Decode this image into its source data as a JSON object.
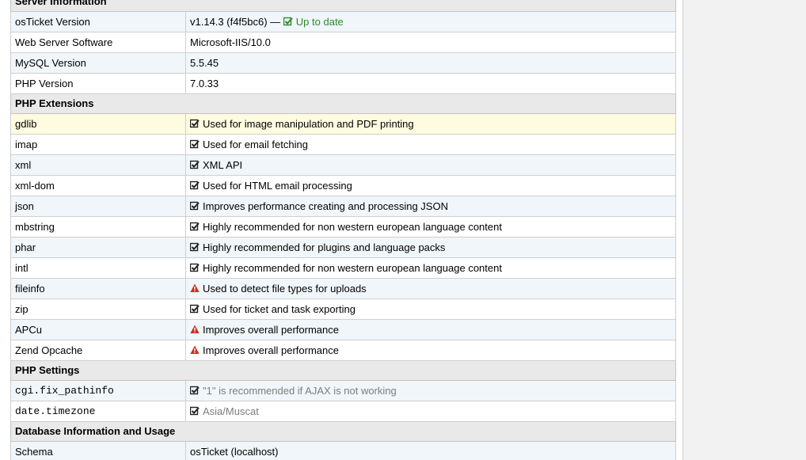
{
  "colors": {
    "ok": "#2c8a2c",
    "warning": "#d02b1f",
    "muted": "#7d7d7d"
  },
  "server": {
    "section_title": "Server Information",
    "rows": {
      "osticket": {
        "label": "osTicket Version",
        "value": "v1.14.3 (f4f5bc6) —",
        "status": "Up to date",
        "status_icon": "check-square-icon"
      },
      "webserver": {
        "label": "Web Server Software",
        "value": "Microsoft-IIS/10.0"
      },
      "mysql": {
        "label": "MySQL Version",
        "value": "5.5.45"
      },
      "php": {
        "label": "PHP Version",
        "value": "7.0.33"
      }
    }
  },
  "extensions": {
    "section_title": "PHP Extensions",
    "rows": [
      {
        "name": "gdlib",
        "icon": "check-square-icon",
        "desc": "Used for image manipulation and PDF printing"
      },
      {
        "name": "imap",
        "icon": "check-square-icon",
        "desc": "Used for email fetching"
      },
      {
        "name": "xml",
        "icon": "check-square-icon",
        "desc": "XML API"
      },
      {
        "name": "xml-dom",
        "icon": "check-square-icon",
        "desc": "Used for HTML email processing"
      },
      {
        "name": "json",
        "icon": "check-square-icon",
        "desc": "Improves performance creating and processing JSON"
      },
      {
        "name": "mbstring",
        "icon": "check-square-icon",
        "desc": "Highly recommended for non western european language content"
      },
      {
        "name": "phar",
        "icon": "check-square-icon",
        "desc": "Highly recommended for plugins and language packs"
      },
      {
        "name": "intl",
        "icon": "check-square-icon",
        "desc": "Highly recommended for non western european language content"
      },
      {
        "name": "fileinfo",
        "icon": "warning-icon",
        "desc": "Used to detect file types for uploads"
      },
      {
        "name": "zip",
        "icon": "check-square-icon",
        "desc": "Used for ticket and task exporting"
      },
      {
        "name": "APCu",
        "icon": "warning-icon",
        "desc": "Improves overall performance"
      },
      {
        "name": "Zend Opcache",
        "icon": "warning-icon",
        "desc": "Improves overall performance"
      }
    ]
  },
  "settings": {
    "section_title": "PHP Settings",
    "rows": [
      {
        "name": "cgi.fix_pathinfo",
        "icon": "check-square-icon",
        "desc": "\"1\" is recommended if AJAX is not working"
      },
      {
        "name": "date.timezone",
        "icon": "check-square-icon",
        "desc": "Asia/Muscat"
      }
    ]
  },
  "database": {
    "section_title": "Database Information and Usage",
    "rows": {
      "schema": {
        "label": "Schema",
        "value": "osTicket (localhost)"
      }
    }
  }
}
